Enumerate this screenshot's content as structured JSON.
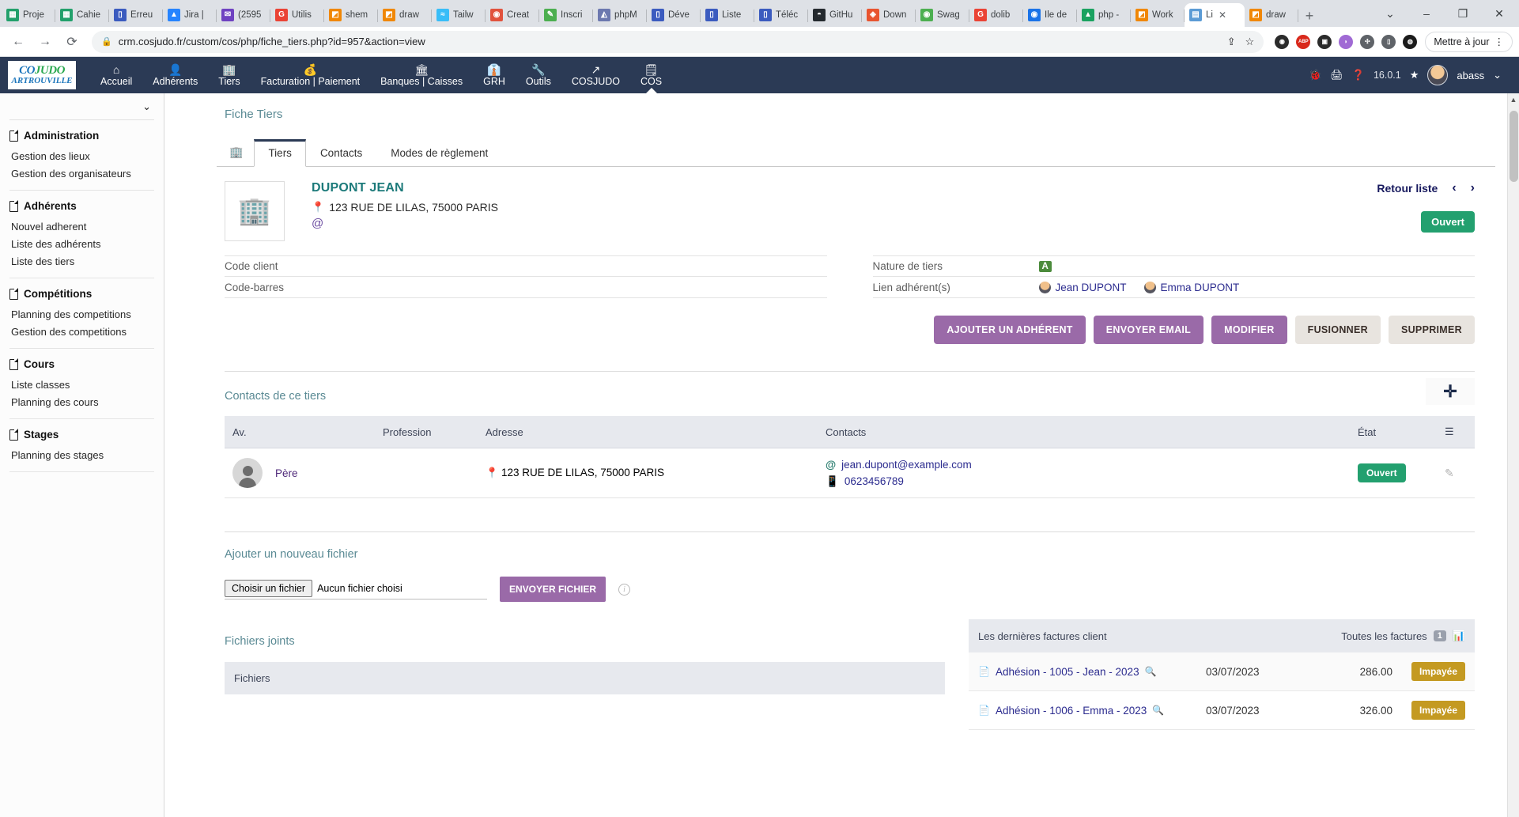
{
  "browser": {
    "tabs": [
      {
        "label": "Proje",
        "icon": "calendar-icon",
        "color": "#22a06b",
        "glyph": "▦",
        "active": false
      },
      {
        "label": "Cahie",
        "icon": "calendar-icon",
        "color": "#22a06b",
        "glyph": "▦",
        "active": false
      },
      {
        "label": "Erreu",
        "icon": "page-icon",
        "color": "#3b5bbf",
        "glyph": "▯",
        "active": false
      },
      {
        "label": "Jira |",
        "icon": "jira-icon",
        "color": "#2684ff",
        "glyph": "▲",
        "active": false
      },
      {
        "label": "(2595",
        "icon": "mail-icon",
        "color": "#6f42c1",
        "glyph": "✉",
        "active": false
      },
      {
        "label": "Utilis",
        "icon": "google-icon",
        "color": "#ea4335",
        "glyph": "G",
        "active": false
      },
      {
        "label": "shem",
        "icon": "drawio-icon",
        "color": "#f08705",
        "glyph": "◩",
        "active": false
      },
      {
        "label": "draw",
        "icon": "drawio-icon",
        "color": "#f08705",
        "glyph": "◩",
        "active": false
      },
      {
        "label": "Tailw",
        "icon": "tailwind-icon",
        "color": "#38bdf8",
        "glyph": "≈",
        "active": false
      },
      {
        "label": "Creat",
        "icon": "flame-icon",
        "color": "#e1523d",
        "glyph": "◉",
        "active": false
      },
      {
        "label": "Inscri",
        "icon": "pen-icon",
        "color": "#4caf50",
        "glyph": "✎",
        "active": false
      },
      {
        "label": "phpM",
        "icon": "phpmyadmin-icon",
        "color": "#6c78af",
        "glyph": "◭",
        "active": false
      },
      {
        "label": "Déve",
        "icon": "page-icon",
        "color": "#3b5bbf",
        "glyph": "▯",
        "active": false
      },
      {
        "label": "Liste",
        "icon": "page-icon",
        "color": "#3b5bbf",
        "glyph": "▯",
        "active": false
      },
      {
        "label": "Téléc",
        "icon": "page-icon",
        "color": "#3b5bbf",
        "glyph": "▯",
        "active": false
      },
      {
        "label": "GitHu",
        "icon": "github-icon",
        "color": "#24292e",
        "glyph": "◓",
        "active": false
      },
      {
        "label": "Down",
        "icon": "diamond-icon",
        "color": "#e8542f",
        "glyph": "◈",
        "active": false
      },
      {
        "label": "Swag",
        "icon": "swagger-icon",
        "color": "#4caf50",
        "glyph": "◉",
        "active": false
      },
      {
        "label": "dolib",
        "icon": "google-icon",
        "color": "#ea4335",
        "glyph": "G",
        "active": false
      },
      {
        "label": "Ile de",
        "icon": "maps-icon",
        "color": "#1a73e8",
        "glyph": "◉",
        "active": false
      },
      {
        "label": "php -",
        "icon": "drive-icon",
        "color": "#1aa260",
        "glyph": "▲",
        "active": false
      },
      {
        "label": "Work",
        "icon": "drawio-icon",
        "color": "#f08705",
        "glyph": "◩",
        "active": false
      },
      {
        "label": "Li",
        "icon": "chart-icon",
        "color": "#5b9bd5",
        "glyph": "▤",
        "active": true
      },
      {
        "label": "draw",
        "icon": "drawio-icon",
        "color": "#f08705",
        "glyph": "◩",
        "active": false
      }
    ],
    "new_tab_label": "+",
    "tab_close_label": "✕",
    "window_controls": [
      "⌄",
      "–",
      "❐",
      "✕"
    ],
    "back_label": "←",
    "forward_label": "→",
    "reload_label": "⟳",
    "url": "crm.cosjudo.fr/custom/cos/php/fiche_tiers.php?id=957&action=view",
    "lock_label": "🔒",
    "share_label": "⇪",
    "bookmark_label": "☆",
    "update_button": "Mettre à jour",
    "menu_label": "⋮",
    "extensions": [
      {
        "name": "pocket-extension-icon",
        "color": "#2b2b2b",
        "glyph": "◉"
      },
      {
        "name": "adblock-extension-icon",
        "color": "#d9291c",
        "glyph": "ABP"
      },
      {
        "name": "gold-extension-icon",
        "color": "#2b2b2b",
        "glyph": "▣"
      },
      {
        "name": "purple-extension-icon",
        "color": "#a06ad4",
        "glyph": "◗"
      },
      {
        "name": "puzzle-extension-icon",
        "color": "#5f6368",
        "glyph": "✣"
      },
      {
        "name": "sidepanel-icon",
        "color": "#5f6368",
        "glyph": "▯"
      },
      {
        "name": "profile-avatar-icon",
        "color": "#1b1b1b",
        "glyph": "◍"
      }
    ]
  },
  "appbar": {
    "logo_line1_a": "CO",
    "logo_line1_b": "JUDO",
    "logo_line2": "ARTROUVILLE",
    "nav": [
      {
        "label": "Accueil",
        "icon": "home-icon",
        "glyph": "⌂",
        "active": false
      },
      {
        "label": "Adhérents",
        "icon": "user-icon",
        "glyph": "👤",
        "active": false
      },
      {
        "label": "Tiers",
        "icon": "building-icon",
        "glyph": "🏢",
        "active": false
      },
      {
        "label": "Facturation | Paiement",
        "icon": "coins-icon",
        "glyph": "💰",
        "active": false
      },
      {
        "label": "Banques | Caisses",
        "icon": "bank-icon",
        "glyph": "🏛",
        "active": false
      },
      {
        "label": "GRH",
        "icon": "employee-icon",
        "glyph": "👔",
        "active": false
      },
      {
        "label": "Outils",
        "icon": "wrench-icon",
        "glyph": "🔧",
        "active": false
      },
      {
        "label": "COSJUDO",
        "icon": "external-link-icon",
        "glyph": "↗",
        "active": false
      },
      {
        "label": "COS",
        "icon": "note-icon",
        "glyph": "🗒",
        "active": true
      }
    ],
    "bug_icon": "🐞",
    "print_icon": "🖨",
    "help_icon": "❓",
    "version": "16.0.1",
    "star_icon": "★",
    "user_name": "abass",
    "chevron": "⌄"
  },
  "sidebar": {
    "collapse_icon": "⌄",
    "groups": [
      {
        "title": "Administration",
        "links": [
          "Gestion des lieux",
          "Gestion des organisateurs"
        ]
      },
      {
        "title": "Adhérents",
        "links": [
          "Nouvel adherent",
          "Liste des adhérents",
          "Liste des tiers"
        ]
      },
      {
        "title": "Compétitions",
        "links": [
          "Planning des competitions",
          "Gestion des competitions"
        ]
      },
      {
        "title": "Cours",
        "links": [
          "Liste classes",
          "Planning des cours"
        ]
      },
      {
        "title": "Stages",
        "links": [
          "Planning des stages"
        ]
      }
    ]
  },
  "main": {
    "breadcrumb": "Fiche Tiers",
    "tab_icon": "building-icon",
    "tabs": [
      {
        "label": "Tiers",
        "active": true
      },
      {
        "label": "Contacts",
        "active": false
      },
      {
        "label": "Modes de règlement",
        "active": false
      }
    ],
    "entity": {
      "logo_icon": "building-icon",
      "name": "DUPONT JEAN",
      "address": "123 RUE DE LILAS, 75000 PARIS",
      "email_icon": "@",
      "back_to_list": "Retour liste",
      "prev_icon": "‹",
      "next_icon": "›",
      "status": "Ouvert",
      "status_color": "#23a06f"
    },
    "fields_left": [
      {
        "label": "Code client",
        "value": ""
      },
      {
        "label": "Code-barres",
        "value": ""
      }
    ],
    "fields_right": [
      {
        "label": "Nature de tiers",
        "value": "A"
      },
      {
        "label": "Lien adhérent(s)",
        "value": ""
      }
    ],
    "linked_members": [
      "Jean DUPONT",
      "Emma DUPONT"
    ],
    "actions": [
      {
        "label": "AJOUTER UN ADHÉRENT",
        "style": "primary"
      },
      {
        "label": "ENVOYER EMAIL",
        "style": "primary"
      },
      {
        "label": "MODIFIER",
        "style": "primary"
      },
      {
        "label": "FUSIONNER",
        "style": "muted"
      },
      {
        "label": "SUPPRIMER",
        "style": "muted"
      }
    ],
    "contacts_section": {
      "title": "Contacts de ce tiers",
      "add_icon": "✛",
      "columns": [
        "Av.",
        "Profession",
        "Adresse",
        "Contacts",
        "État",
        "☰"
      ],
      "rows": [
        {
          "avatar": "avatar-icon",
          "role": "Père",
          "profession": "",
          "address": "123 RUE DE LILAS, 75000 PARIS",
          "email": "jean.dupont@example.com",
          "phone": "0623456789",
          "status": "Ouvert",
          "edit_icon": "✎"
        }
      ]
    },
    "upload": {
      "title": "Ajouter un nouveau fichier",
      "choose_button": "Choisir un fichier",
      "no_file_text": "Aucun fichier choisi",
      "send_button": "ENVOYER FICHIER",
      "info_icon": "i"
    },
    "files": {
      "title": "Fichiers joints",
      "header": "Fichiers"
    },
    "invoices": {
      "title": "Les dernières factures client",
      "all_link": "Toutes les factures",
      "count": "1",
      "chart_icon": "📊",
      "rows": [
        {
          "name": "Adhésion - 1005 - Jean - 2023",
          "zoom_icon": "🔍",
          "date": "03/07/2023",
          "amount": "286.00",
          "status": "Impayée"
        },
        {
          "name": "Adhésion - 1006 - Emma - 2023",
          "zoom_icon": "🔍",
          "date": "03/07/2023",
          "amount": "326.00",
          "status": "Impayée"
        }
      ]
    }
  }
}
